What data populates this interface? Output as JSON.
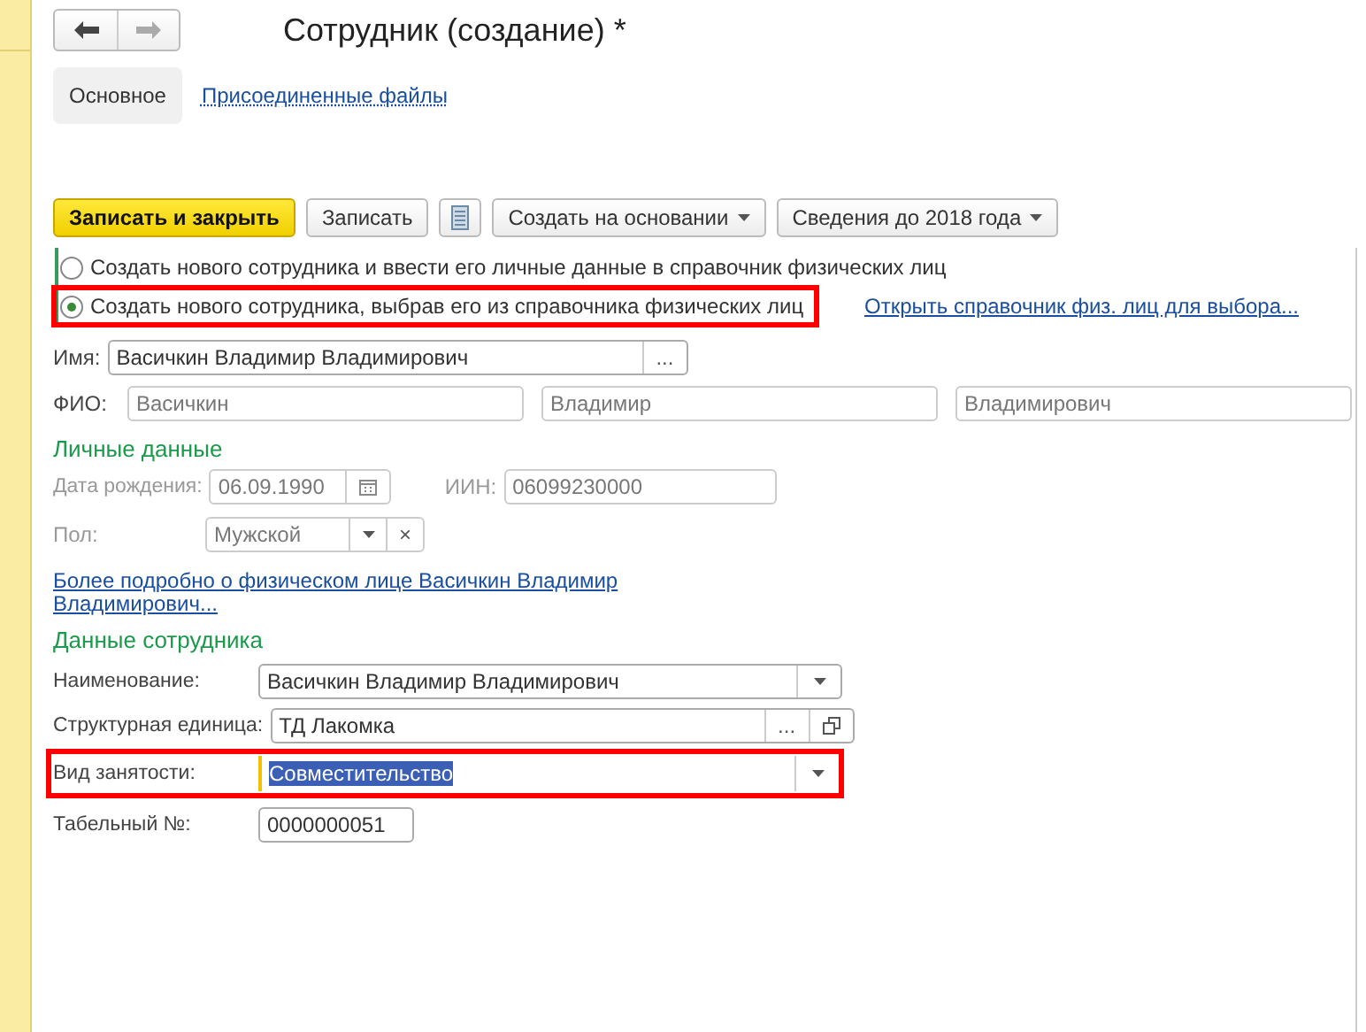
{
  "nav": {
    "back_enabled": true,
    "forward_enabled": false
  },
  "title": "Сотрудник (создание) *",
  "tabs": [
    {
      "label": "Основное",
      "selected": true
    },
    {
      "label": "Присоединенные файлы",
      "selected": false
    }
  ],
  "toolbar": [
    {
      "kind": "primary",
      "label": "Записать и закрыть"
    },
    {
      "kind": "normal",
      "label": "Записать"
    },
    {
      "kind": "list-icon"
    },
    {
      "kind": "menu",
      "label": "Создать на основании"
    },
    {
      "kind": "menu",
      "label": "Сведения до 2018 года"
    }
  ],
  "radios": [
    {
      "label": "Создать нового сотрудника и ввести его личные данные в справочник физических лиц",
      "selected": false,
      "highlighted": false
    },
    {
      "label": "Создать нового сотрудника, выбрав его из справочника физических лиц",
      "selected": true,
      "highlighted": true
    }
  ],
  "open_link": "Открыть справочник физ. лиц для выбора...",
  "name_field": {
    "label": "Имя:",
    "value": "Васичкин Владимир Владимирович",
    "button": "..."
  },
  "fio": {
    "label": "ФИО:",
    "parts": [
      "Васичкин",
      "Владимир",
      "Владимирович"
    ]
  },
  "personal": {
    "title": "Личные данные",
    "birth_date": {
      "label": "Дата рождения:",
      "value": "06.09.1990",
      "disabled": true
    },
    "iin": {
      "label": "ИИН:",
      "value": "06099230000",
      "disabled": true
    },
    "gender": {
      "label": "Пол:",
      "value": "Мужской",
      "disabled": true,
      "clear": "×"
    },
    "more_link": "Более подробно о физическом лице Васичкин Владимир Владимирович..."
  },
  "employee": {
    "title": "Данные сотрудника",
    "fields": [
      {
        "kind": "dropdown",
        "label": "Наименование:",
        "value": "Васичкин Владимир Владимирович",
        "highlighted": false,
        "focused": false
      },
      {
        "kind": "choice",
        "label": "Структурная единица:",
        "value": "ТД Лакомка",
        "button": "...",
        "highlighted": false,
        "focused": false
      },
      {
        "kind": "dropdown",
        "label": "Вид занятости:",
        "value": "Совместительство",
        "highlighted": true,
        "focused": true
      },
      {
        "kind": "text",
        "label": "Табельный №:",
        "value": "0000000051",
        "highlighted": false,
        "focused": false
      }
    ]
  }
}
